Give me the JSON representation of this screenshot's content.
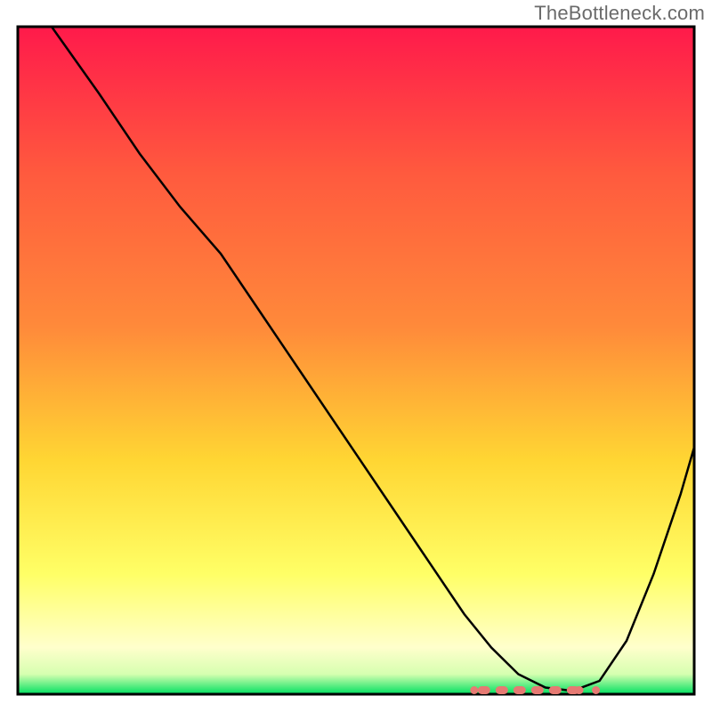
{
  "watermark": "TheBottleneck.com",
  "chart_data": {
    "type": "line",
    "title": "",
    "xlabel": "",
    "ylabel": "",
    "xlim": [
      0,
      100
    ],
    "ylim": [
      0,
      100
    ],
    "background_gradient": {
      "top": "#ff1a4b",
      "mid_upper": "#ff8a3a",
      "mid": "#ffd633",
      "mid_lower": "#ffff66",
      "lower": "#ffffcc",
      "bottom": "#00e060"
    },
    "series": [
      {
        "name": "curve",
        "color": "#000000",
        "x": [
          5,
          12,
          18,
          24,
          30,
          36,
          42,
          48,
          54,
          60,
          66,
          70,
          74,
          78,
          82,
          86,
          90,
          94,
          98,
          100
        ],
        "y": [
          100,
          90,
          81,
          73,
          66,
          57,
          48,
          39,
          30,
          21,
          12,
          7,
          3,
          1,
          0.5,
          2,
          8,
          18,
          30,
          37
        ]
      }
    ],
    "marker_band": {
      "name": "optimal-range",
      "color": "#e67a73",
      "x_start": 68,
      "x_end": 86,
      "y": 0.6
    },
    "axes_color": "#000000"
  }
}
